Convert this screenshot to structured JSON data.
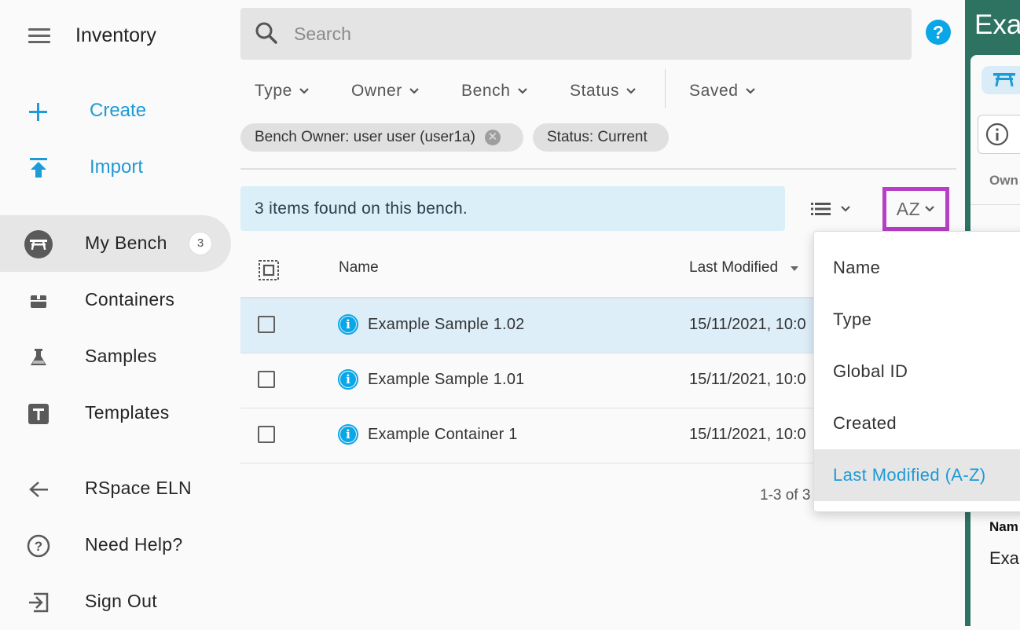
{
  "app": {
    "title": "Inventory"
  },
  "sidebar": {
    "actions": [
      {
        "label": "Create",
        "icon": "plus-icon"
      },
      {
        "label": "Import",
        "icon": "import-icon"
      }
    ],
    "nav": [
      {
        "label": "My Bench",
        "icon": "bench-icon",
        "count": "3",
        "active": true
      },
      {
        "label": "Containers",
        "icon": "container-icon"
      },
      {
        "label": "Samples",
        "icon": "flask-icon"
      },
      {
        "label": "Templates",
        "icon": "template-icon"
      }
    ],
    "footer": [
      {
        "label": "RSpace ELN",
        "icon": "arrow-left-icon"
      },
      {
        "label": "Need Help?",
        "icon": "help-circle-icon"
      },
      {
        "label": "Sign Out",
        "icon": "sign-out-icon"
      }
    ]
  },
  "search": {
    "placeholder": "Search"
  },
  "help_button": "?",
  "filters": [
    "Type",
    "Owner",
    "Bench",
    "Status",
    "Saved"
  ],
  "chips": [
    {
      "label": "Bench Owner: user user (user1a)",
      "removable": true
    },
    {
      "label": "Status: Current",
      "removable": false
    }
  ],
  "results": {
    "banner": "3 items found on this bench.",
    "sort_label": "AZ",
    "columns": {
      "name": "Name",
      "modified": "Last Modified"
    },
    "rows": [
      {
        "name": "Example Sample 1.02",
        "modified": "15/11/2021, 10:0",
        "selected": true
      },
      {
        "name": "Example Sample 1.01",
        "modified": "15/11/2021, 10:0",
        "selected": false
      },
      {
        "name": "Example Container 1",
        "modified": "15/11/2021, 10:0",
        "selected": false
      }
    ],
    "pagination": "1-3 of 3"
  },
  "sort_menu": {
    "items": [
      "Name",
      "Type",
      "Global ID",
      "Created",
      "Last Modified (A-Z)"
    ],
    "active_index": 4
  },
  "right_pane": {
    "title": "Exa",
    "owner_label": "Own",
    "name_label": "Nam",
    "name_value": "Exa"
  },
  "colors": {
    "accent": "#1e9ad6",
    "info_blue": "#0aa7e8",
    "highlight_border": "#b73ec6",
    "right_pane_bg": "#2e7261",
    "selected_row": "#ddeef9",
    "banner_bg": "#dbeff8"
  }
}
